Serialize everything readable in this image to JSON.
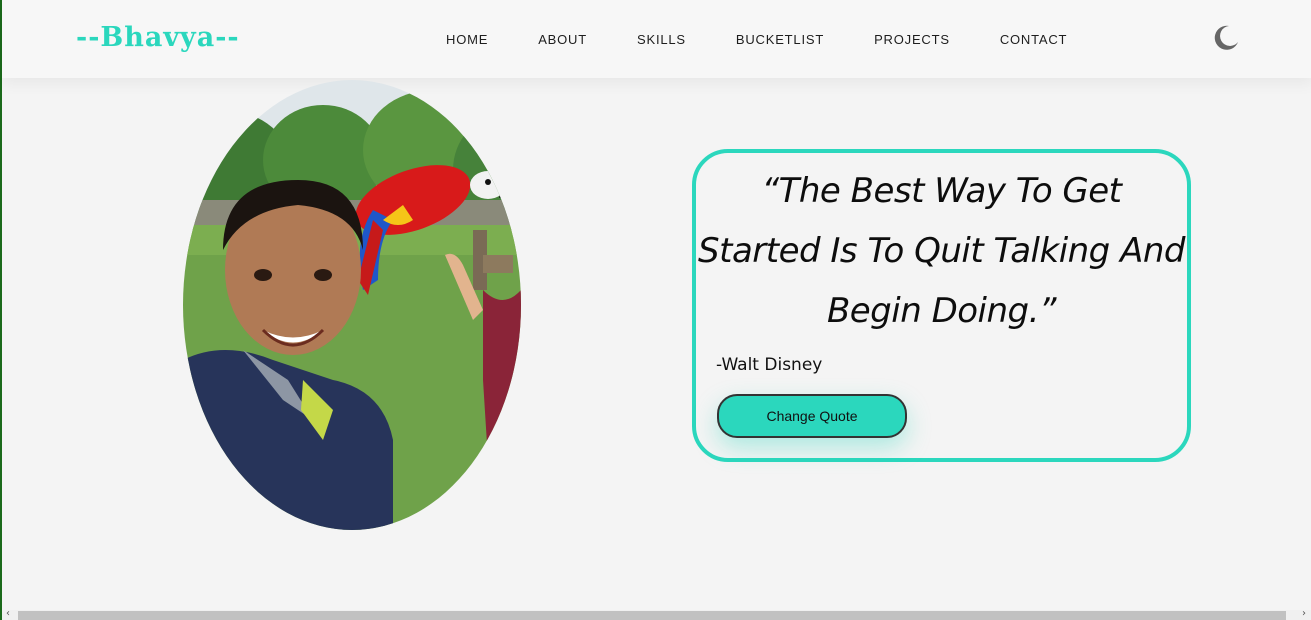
{
  "brand": {
    "logo_text": "--Bhavya--",
    "accent_color": "#2bd7bd"
  },
  "nav": {
    "items": [
      {
        "label": "HOME"
      },
      {
        "label": "ABOUT"
      },
      {
        "label": "SKILLS"
      },
      {
        "label": "BUCKETLIST"
      },
      {
        "label": "PROJECTS"
      },
      {
        "label": "CONTACT"
      }
    ],
    "theme_icon": "moon-icon"
  },
  "hero": {
    "photo_icon": "profile-photo",
    "quote": "“The Best Way To Get Started Is To Quit Talking And Begin Doing.”",
    "author": "-Walt Disney",
    "button_label": "Change Quote"
  },
  "scrollbar": {
    "left_arrow": "‹",
    "right_arrow": "›"
  }
}
